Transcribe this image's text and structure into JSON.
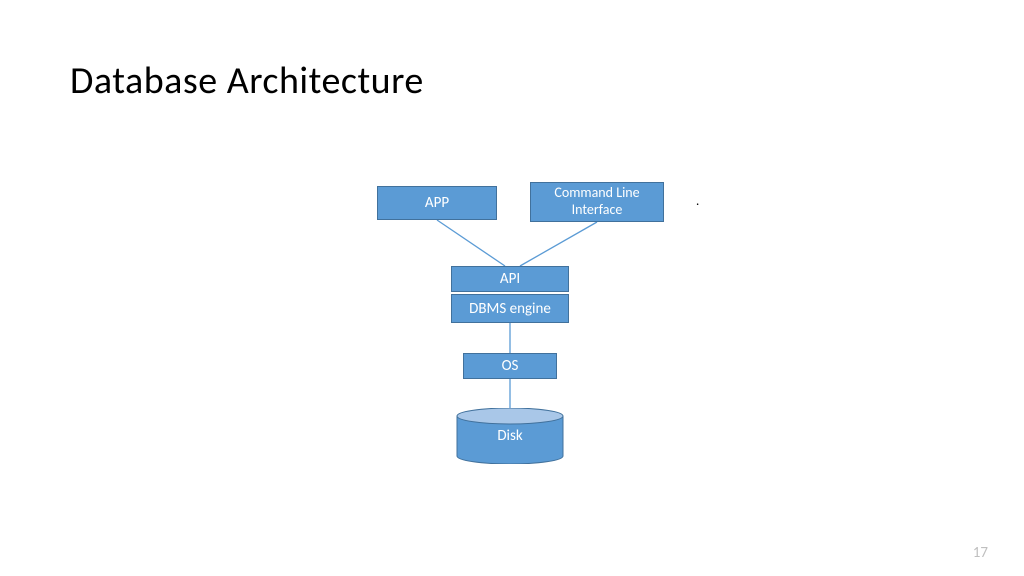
{
  "title": "Database Architecture",
  "nodes": {
    "app": "APP",
    "cli": "Command Line Interface",
    "api": "API",
    "dbms": "DBMS engine",
    "os": "OS",
    "disk": "Disk"
  },
  "page_number": "17",
  "dot": "."
}
